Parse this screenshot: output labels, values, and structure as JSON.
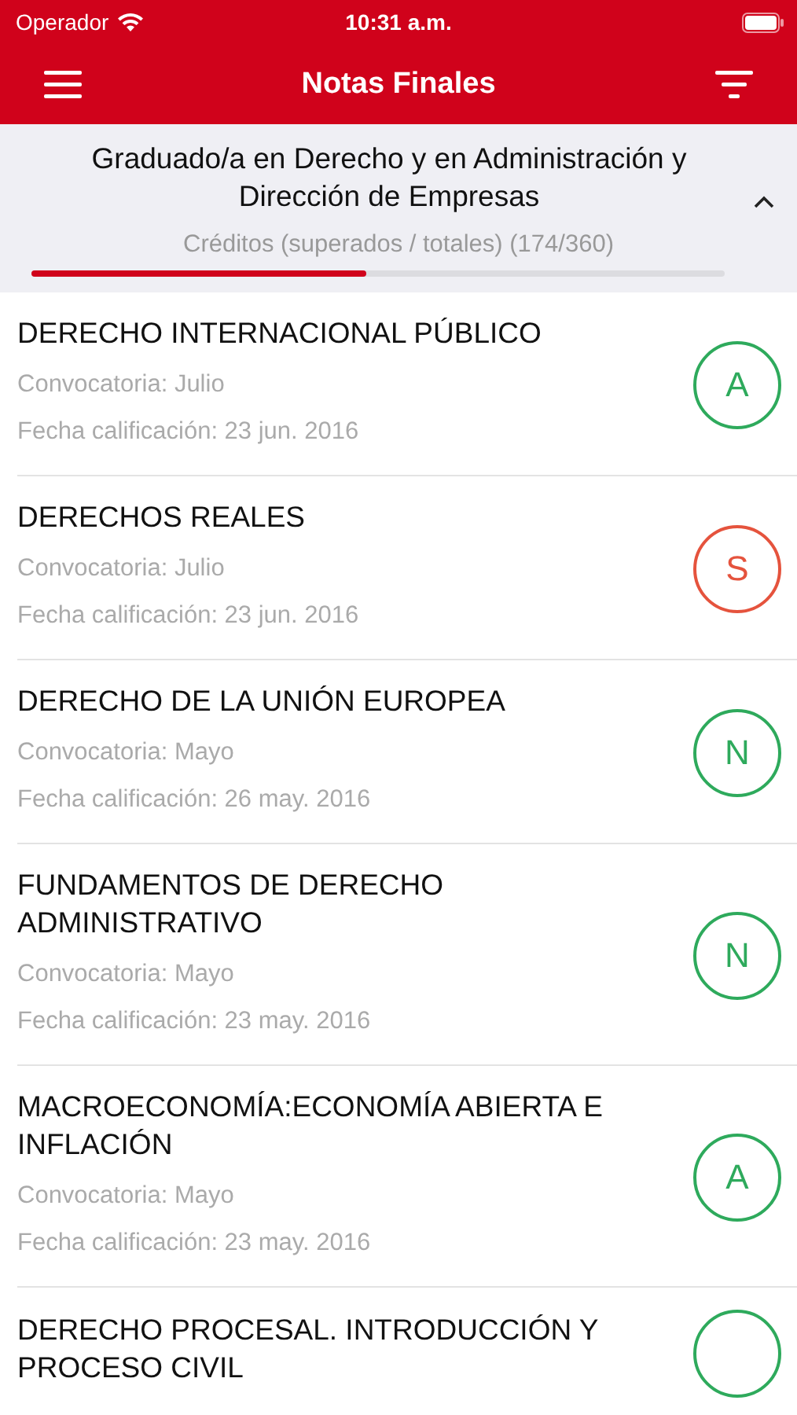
{
  "status_bar": {
    "carrier": "Operador",
    "time": "10:31 a.m."
  },
  "nav": {
    "title": "Notas Finales"
  },
  "degree": {
    "title": "Graduado/a en Derecho y en Administración y Dirección de Empresas",
    "expanded": true,
    "credits": "Créditos (superados / totales) (174/360)",
    "level": 0.484
  },
  "subjects": [
    {
      "name": "DERECHO INTERNACIONAL PÚBLICO",
      "session": "Convocatoria: Julio",
      "date": "Fecha calificación: 23 jun. 2016",
      "grade": "A",
      "color": "#2eaa5c"
    },
    {
      "name": "DERECHOS REALES",
      "session": "Convocatoria: Julio",
      "date": "Fecha calificación: 23 jun. 2016",
      "grade": "S",
      "color": "#e5533d"
    },
    {
      "name": "DERECHO DE LA UNIÓN EUROPEA",
      "session": "Convocatoria: Mayo",
      "date": "Fecha calificación: 26 may. 2016",
      "grade": "N",
      "color": "#2eaa5c"
    },
    {
      "name": "FUNDAMENTOS DE DERECHO ADMINISTRATIVO",
      "session": "Convocatoria: Mayo",
      "date": "Fecha calificación: 23 may. 2016",
      "grade": "N",
      "color": "#2eaa5c"
    },
    {
      "name": "MACROECONOMÍA:ECONOMÍA ABIERTA E INFLACIÓN",
      "session": "Convocatoria: Mayo",
      "date": "Fecha calificación: 23 may. 2016",
      "grade": "A",
      "color": "#2eaa5c"
    },
    {
      "name": "DERECHO PROCESAL. INTRODUCCIÓN Y PROCESO CIVIL",
      "color": "#2eaa5c"
    }
  ]
}
